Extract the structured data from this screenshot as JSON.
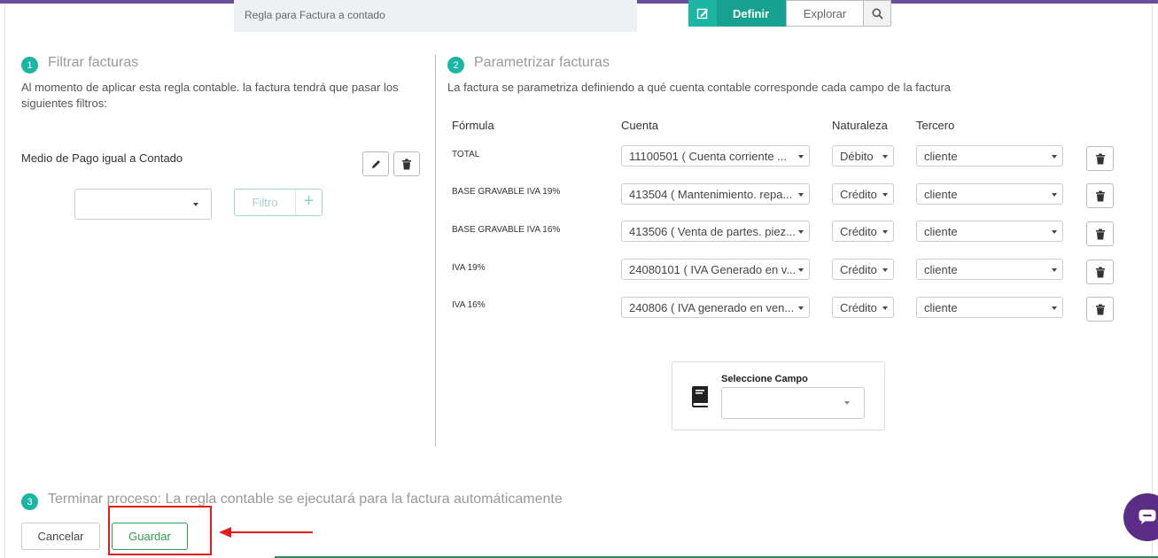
{
  "header": {
    "rule_name": "Regla para Factura a contado",
    "tabs": {
      "definir": "Definir",
      "explorar": "Explorar"
    },
    "icons": {
      "edit": "edit-icon",
      "search": "search-icon"
    }
  },
  "step1": {
    "number": "1",
    "title": "Filtrar facturas",
    "description": "Al momento de aplicar esta regla contable. la factura tendrá que pasar los siguientes filtros:",
    "filter_text": "Medio de Pago igual a Contado",
    "filter_select_value": "",
    "filter_button": "Filtro",
    "filter_button_plus": "+"
  },
  "step2": {
    "number": "2",
    "title": "Parametrizar facturas",
    "description": "La factura se parametriza definiendo a qué cuenta contable corresponde cada campo de la factura",
    "columns": {
      "formula": "Fórmula",
      "cuenta": "Cuenta",
      "naturaleza": "Naturaleza",
      "tercero": "Tercero"
    },
    "rows": [
      {
        "formula": "TOTAL",
        "cuenta": "11100501 ( Cuenta corriente ...",
        "naturaleza": "Débito",
        "tercero": "cliente"
      },
      {
        "formula": "BASE GRAVABLE IVA 19%",
        "cuenta": "413504 ( Mantenimiento. repa...",
        "naturaleza": "Crédito",
        "tercero": "cliente"
      },
      {
        "formula": "BASE GRAVABLE IVA 16%",
        "cuenta": "413506 ( Venta de partes. piez...",
        "naturaleza": "Crédito",
        "tercero": "cliente"
      },
      {
        "formula": "IVA 19%",
        "cuenta": "24080101 ( IVA Generado en v...",
        "naturaleza": "Crédito",
        "tercero": "cliente"
      },
      {
        "formula": "IVA 16%",
        "cuenta": "240806 ( IVA generado en ven...",
        "naturaleza": "Crédito",
        "tercero": "cliente"
      }
    ],
    "campo_label": "Seleccione Campo",
    "campo_value": ""
  },
  "step3": {
    "number": "3",
    "title": "Terminar proceso: La regla contable se ejecutará para la factura automáticamente",
    "cancel": "Cancelar",
    "save": "Guardar"
  },
  "colors": {
    "accent": "#1cb5a3",
    "save": "#2f9e4c",
    "highlight": "#e31b1b",
    "chat": "#5b2d86"
  }
}
